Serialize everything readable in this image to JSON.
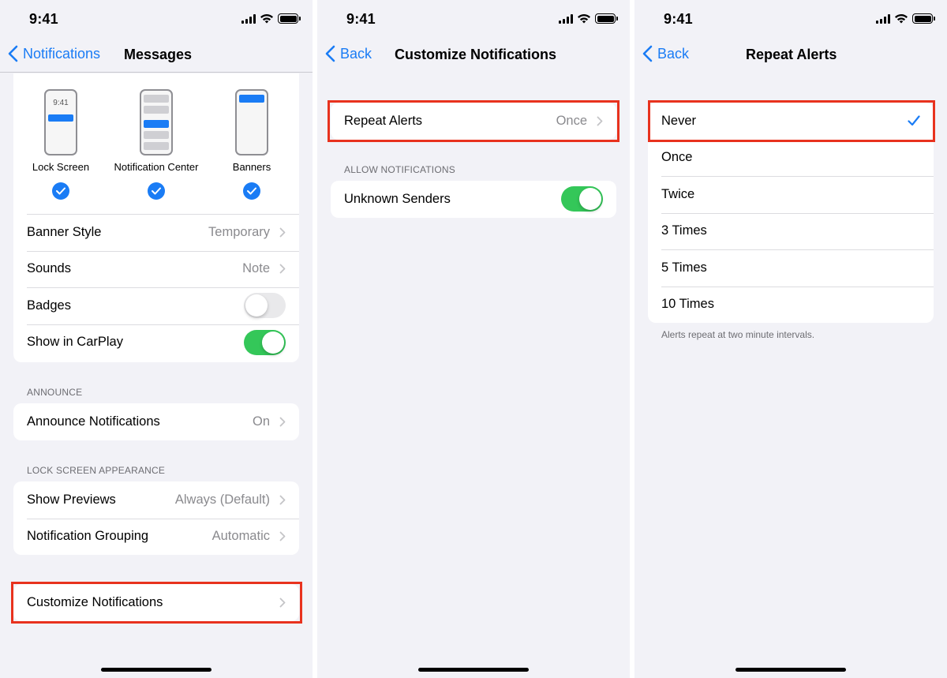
{
  "status": {
    "time": "9:41"
  },
  "screen1": {
    "back_label": "Notifications",
    "title": "Messages",
    "alert_styles": [
      {
        "caption": "Lock Screen",
        "phone_time": "9:41"
      },
      {
        "caption": "Notification Center"
      },
      {
        "caption": "Banners"
      }
    ],
    "banner_style": {
      "label": "Banner Style",
      "value": "Temporary"
    },
    "sounds": {
      "label": "Sounds",
      "value": "Note"
    },
    "badges": {
      "label": "Badges",
      "on": false
    },
    "carplay": {
      "label": "Show in CarPlay",
      "on": true
    },
    "announce_header": "ANNOUNCE",
    "announce": {
      "label": "Announce Notifications",
      "value": "On"
    },
    "lock_header": "LOCK SCREEN APPEARANCE",
    "show_previews": {
      "label": "Show Previews",
      "value": "Always (Default)"
    },
    "grouping": {
      "label": "Notification Grouping",
      "value": "Automatic"
    },
    "customize": {
      "label": "Customize Notifications"
    }
  },
  "screen2": {
    "back_label": "Back",
    "title": "Customize Notifications",
    "repeat_alerts": {
      "label": "Repeat Alerts",
      "value": "Once"
    },
    "allow_header": "ALLOW NOTIFICATIONS",
    "unknown_senders": {
      "label": "Unknown Senders",
      "on": true
    }
  },
  "screen3": {
    "back_label": "Back",
    "title": "Repeat Alerts",
    "options": [
      "Never",
      "Once",
      "Twice",
      "3 Times",
      "5 Times",
      "10 Times"
    ],
    "selected": "Never",
    "footer": "Alerts repeat at two minute intervals."
  },
  "colors": {
    "accent": "#1a7cf5",
    "toggle_on": "#34c759",
    "highlight": "#e8321e"
  }
}
